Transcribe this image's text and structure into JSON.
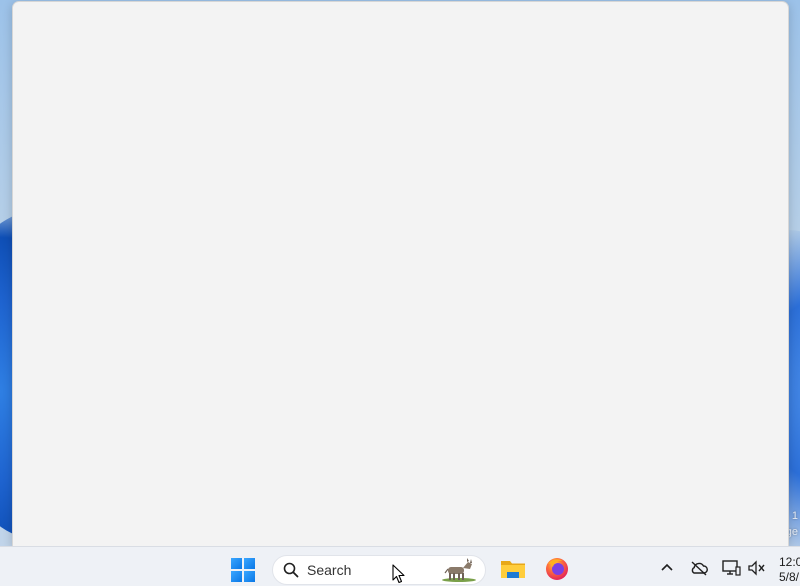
{
  "desktop": {
    "corner_text_line1": "1",
    "corner_text_line2": "ge"
  },
  "taskbar": {
    "start_icon": "windows-start-icon",
    "search": {
      "label": "Search",
      "icon": "search-icon",
      "highlight_icon": "donkey-icon"
    },
    "apps": [
      {
        "name": "File Explorer",
        "icon": "folder-icon"
      },
      {
        "name": "Firefox",
        "icon": "firefox-icon"
      }
    ],
    "tray": [
      {
        "icon": "chevron-up-icon"
      },
      {
        "icon": "onedrive-cloud-off-icon"
      },
      {
        "icon": "display-icon"
      },
      {
        "icon": "speaker-muted-icon"
      }
    ],
    "clock": {
      "time": "12:0",
      "date": "5/8/"
    }
  },
  "colors": {
    "window_background": "#f3f3f3",
    "taskbar_background": "#eef1f6",
    "accent_blue": "#0a78e6",
    "firefox_orange": "#ff7139"
  }
}
